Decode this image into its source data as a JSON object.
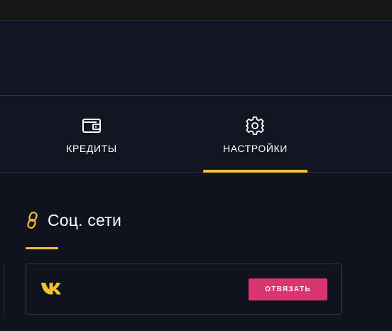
{
  "tabs": [
    {
      "label": "КРЕДИТЫ",
      "icon": "wallet-icon",
      "active": false
    },
    {
      "label": "НАСТРОЙКИ",
      "icon": "gear-icon",
      "active": true
    }
  ],
  "section": {
    "title": "Соц. сети",
    "icon": "link-icon"
  },
  "social": {
    "network_icon": "vk-icon",
    "unlink_label": "ОТВЯЗАТЬ"
  },
  "colors": {
    "accent": "#f2c230",
    "button": "#d9356e",
    "background": "#10121d",
    "panel": "#121522",
    "border": "#2b2e3a"
  }
}
